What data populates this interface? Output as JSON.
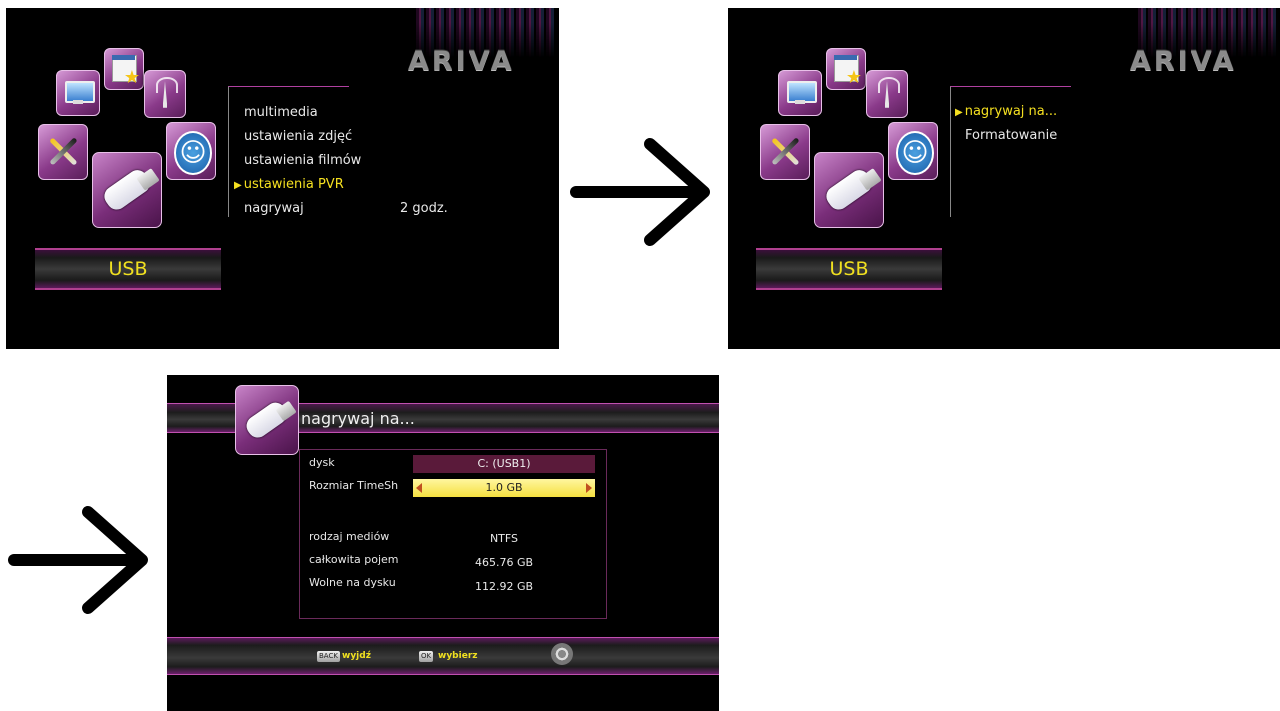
{
  "brand": {
    "logo_text": "ARIVA"
  },
  "menu_screen": {
    "category_label": "USB",
    "items": [
      {
        "label": "multimedia",
        "value": "",
        "active": false
      },
      {
        "label": "ustawienia zdjęć",
        "value": "",
        "active": false
      },
      {
        "label": "ustawienia filmów",
        "value": "",
        "active": false
      },
      {
        "label": "ustawienia PVR",
        "value": "",
        "active": true
      },
      {
        "label": "nagrywaj",
        "value": "2 godz.",
        "active": false
      }
    ]
  },
  "submenu_screen": {
    "category_label": "USB",
    "items": [
      {
        "label": "nagrywaj na...",
        "active": true
      },
      {
        "label": "Formatowanie",
        "active": false
      }
    ]
  },
  "detail_screen": {
    "title": "nagrywaj na...",
    "fields": [
      {
        "label": "dysk",
        "value": "C: (USB1)"
      },
      {
        "label": "Rozmiar TimeSh",
        "value": "1.0 GB"
      },
      {
        "label": "rodzaj mediów",
        "value": "NTFS"
      },
      {
        "label": "całkowita pojem",
        "value": "465.76 GB"
      },
      {
        "label": "Wolne na dysku",
        "value": "112.92 GB"
      }
    ],
    "footer": {
      "back_key": "BACK",
      "back_label": "wyjdź",
      "ok_key": "OK",
      "ok_label": "wybierz"
    }
  },
  "colors": {
    "accent_magenta": "#b0408f",
    "highlight_yellow": "#f5e020",
    "screen_bg": "#000000"
  },
  "icons": [
    "monitor-icon",
    "document-star-icon",
    "antenna-icon",
    "tools-icon",
    "accessibility-icon",
    "usb-drive-icon",
    "right-arrow-icon",
    "dpad-icon"
  ]
}
